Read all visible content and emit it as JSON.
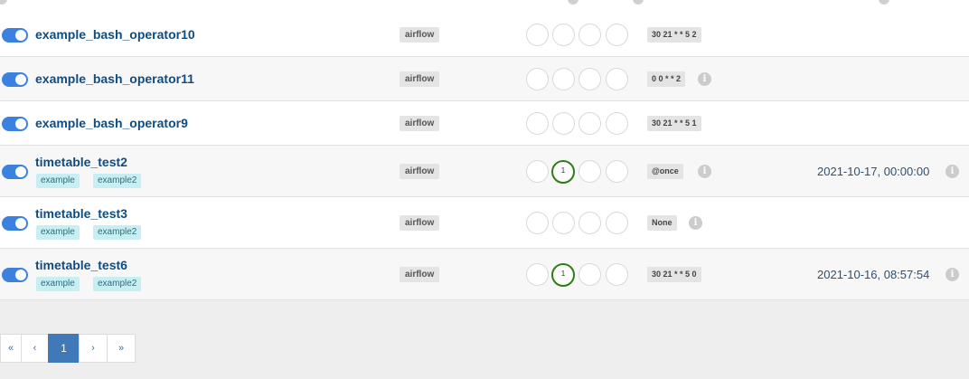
{
  "rows": [
    {
      "name": "example_bash_operator10",
      "tags": [],
      "owner": "airflow",
      "recent_runs": [],
      "schedule": "30 21 * * 5 2",
      "schedule_info_icon": false,
      "last_run": ""
    },
    {
      "name": "example_bash_operator11",
      "tags": [],
      "owner": "airflow",
      "recent_runs": [],
      "schedule": "0 0 * * 2",
      "schedule_info_icon": true,
      "last_run": ""
    },
    {
      "name": "example_bash_operator9",
      "tags": [],
      "owner": "airflow",
      "recent_runs": [],
      "schedule": "30 21 * * 5 1",
      "schedule_info_icon": false,
      "last_run": ""
    },
    {
      "name": "timetable_test2",
      "tags": [
        "example",
        "example2"
      ],
      "owner": "airflow",
      "recent_runs": [
        "1"
      ],
      "schedule": "@once",
      "schedule_info_icon": true,
      "last_run": "2021-10-17, 00:00:00"
    },
    {
      "name": "timetable_test3",
      "tags": [
        "example",
        "example2"
      ],
      "owner": "airflow",
      "recent_runs": [],
      "schedule": "None",
      "schedule_info_icon": true,
      "last_run": ""
    },
    {
      "name": "timetable_test6",
      "tags": [
        "example",
        "example2"
      ],
      "owner": "airflow",
      "recent_runs": [
        "1"
      ],
      "schedule": "30 21 * * 5 0",
      "schedule_info_icon": false,
      "last_run": "2021-10-16, 08:57:54"
    }
  ],
  "pagination": {
    "first": "«",
    "prev": "‹",
    "current": "1",
    "next": "›",
    "last": "»"
  },
  "colors": {
    "toggle_on": "#3b82e0",
    "dag_link": "#0f4c81",
    "run_success": "#2e7d18",
    "tag_bg": "#c7eef2",
    "pager_active": "#4078b8"
  },
  "icons": {
    "info": "i"
  }
}
